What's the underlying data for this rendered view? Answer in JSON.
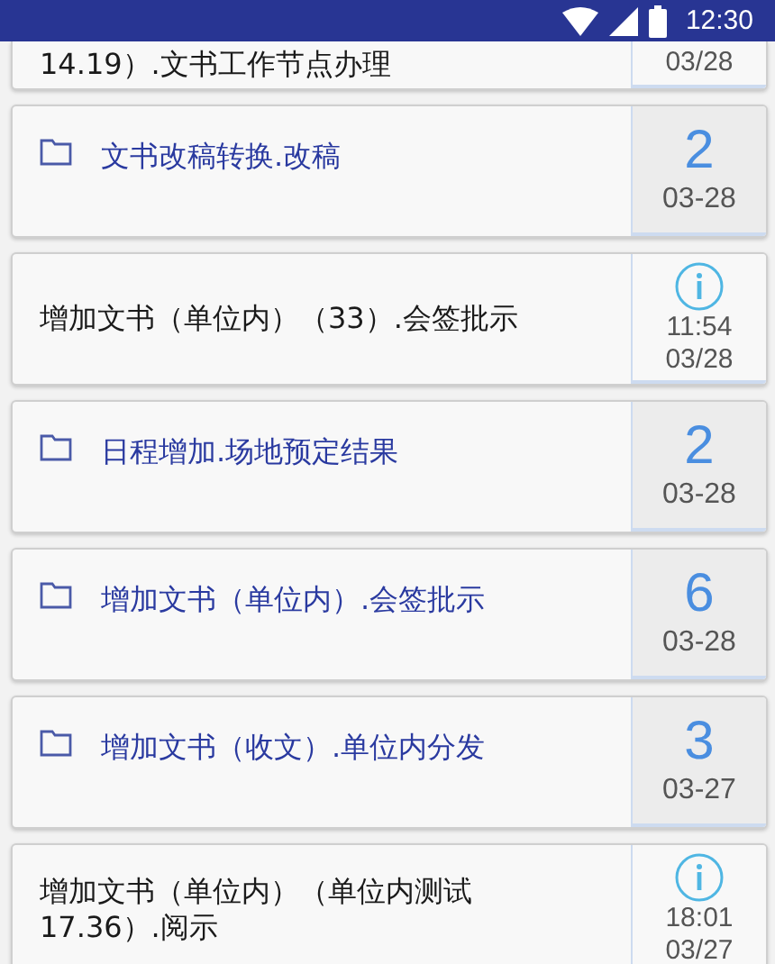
{
  "status_bar": {
    "time": "12:30"
  },
  "items": [
    {
      "kind": "message",
      "title": "14.19）.文书工作节点办理",
      "date": "03/28"
    },
    {
      "kind": "folder",
      "title": "文书改稿转换.改稿",
      "count": "2",
      "date": "03-28"
    },
    {
      "kind": "message",
      "title": "增加文书（单位内）（33）.会签批示",
      "time": "11:54",
      "date": "03/28"
    },
    {
      "kind": "folder",
      "title": "日程增加.场地预定结果",
      "count": "2",
      "date": "03-28"
    },
    {
      "kind": "folder",
      "title": "增加文书（单位内）.会签批示",
      "count": "6",
      "date": "03-28"
    },
    {
      "kind": "folder",
      "title": "增加文书（收文）.单位内分发",
      "count": "3",
      "date": "03-27"
    },
    {
      "kind": "message",
      "title": "增加文书（单位内）（单位内测试17.36）.阅示",
      "time": "18:01",
      "date": "03/27"
    }
  ]
}
